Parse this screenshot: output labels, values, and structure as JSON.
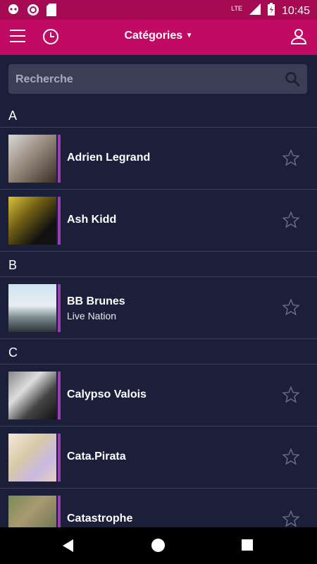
{
  "status": {
    "time": "10:45",
    "network": "LTE"
  },
  "header": {
    "title": "Catégories"
  },
  "search": {
    "placeholder": "Recherche"
  },
  "sections": [
    {
      "letter": "A",
      "items": [
        {
          "name": "Adrien Legrand",
          "subtitle": ""
        },
        {
          "name": "Ash Kidd",
          "subtitle": ""
        }
      ]
    },
    {
      "letter": "B",
      "items": [
        {
          "name": "BB Brunes",
          "subtitle": "Live Nation"
        }
      ]
    },
    {
      "letter": "C",
      "items": [
        {
          "name": "Calypso Valois",
          "subtitle": ""
        },
        {
          "name": "Cata.Pirata",
          "subtitle": ""
        },
        {
          "name": "Catastrophe",
          "subtitle": ""
        }
      ]
    }
  ],
  "colors": {
    "statusbar": "#a50a52",
    "appbar": "#c00a63",
    "background": "#1b1f3a",
    "accent_bar": "#9b3fb2"
  }
}
